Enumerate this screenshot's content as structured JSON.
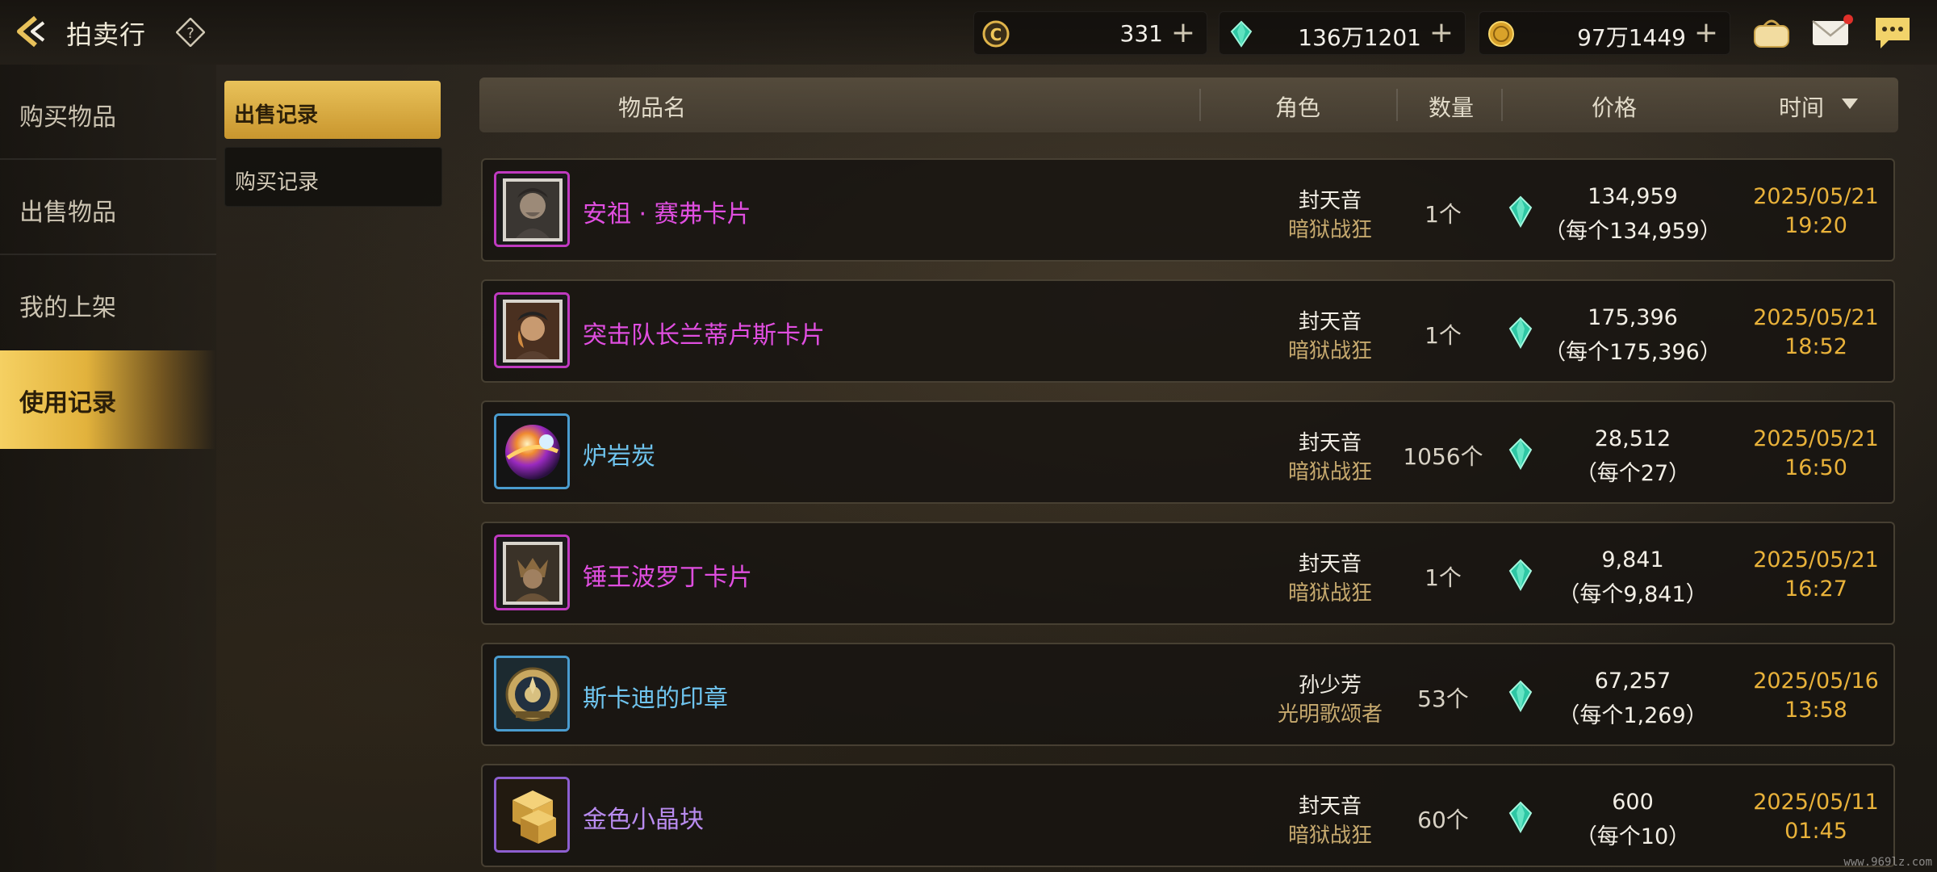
{
  "header": {
    "title": "拍卖行",
    "currencies": [
      {
        "icon": "c-coin-icon",
        "value": "331"
      },
      {
        "icon": "green-gem-icon",
        "value": "136万1201"
      },
      {
        "icon": "gold-coin-icon",
        "value": "97万1449"
      }
    ]
  },
  "nav": {
    "items": [
      {
        "label": "购买物品"
      },
      {
        "label": "出售物品"
      },
      {
        "label": "我的上架"
      },
      {
        "label": "使用记录",
        "active": true
      }
    ]
  },
  "subtabs": [
    {
      "label": "出售记录",
      "active": true
    },
    {
      "label": "购买记录"
    }
  ],
  "table": {
    "columns": {
      "item": "物品名",
      "role": "角色",
      "qty": "数量",
      "price": "价格",
      "time": "时间"
    },
    "rows": [
      {
        "name": "安祖 · 赛弗卡片",
        "name_color": "#e04ee0",
        "frame": "#c03ac0",
        "kind": "card-portrait-1",
        "char": "封天音",
        "class": "暗狱战狂",
        "qty": "1个",
        "price": "134,959",
        "unit": "（每个134,959）",
        "date": "2025/05/21",
        "time": "19:20"
      },
      {
        "name": "突击队长兰蒂卢斯卡片",
        "name_color": "#e04ee0",
        "frame": "#c03ac0",
        "kind": "card-portrait-2",
        "char": "封天音",
        "class": "暗狱战狂",
        "qty": "1个",
        "price": "175,396",
        "unit": "（每个175,396）",
        "date": "2025/05/21",
        "time": "18:52"
      },
      {
        "name": "炉岩炭",
        "name_color": "#6fc4ee",
        "frame": "#4a9ccf",
        "kind": "orb",
        "char": "封天音",
        "class": "暗狱战狂",
        "qty": "1056个",
        "price": "28,512",
        "unit": "（每个27）",
        "date": "2025/05/21",
        "time": "16:50"
      },
      {
        "name": "锤王波罗丁卡片",
        "name_color": "#e04ee0",
        "frame": "#c03ac0",
        "kind": "card-portrait-3",
        "char": "封天音",
        "class": "暗狱战狂",
        "qty": "1个",
        "price": "9,841",
        "unit": "（每个9,841）",
        "date": "2025/05/21",
        "time": "16:27"
      },
      {
        "name": "斯卡迪的印章",
        "name_color": "#6fc4ee",
        "frame": "#4a9ccf",
        "kind": "seal",
        "char": "孙少芳",
        "class": "光明歌颂者",
        "qty": "53个",
        "price": "67,257",
        "unit": "（每个1,269）",
        "date": "2025/05/16",
        "time": "13:58"
      },
      {
        "name": "金色小晶块",
        "name_color": "#b98cf0",
        "frame": "#8d5fd0",
        "kind": "gold-cubes",
        "char": "封天音",
        "class": "暗狱战狂",
        "qty": "60个",
        "price": "600",
        "unit": "（每个10）",
        "date": "2025/05/11",
        "time": "01:45"
      }
    ]
  },
  "watermark": "www.969lz.com",
  "colors": {
    "accent_gold": "#e9b23a",
    "nav_active": "#f5d062",
    "card_name": "#e04ee0",
    "material_name": "#6fc4ee",
    "rare_name": "#b98cf0"
  }
}
